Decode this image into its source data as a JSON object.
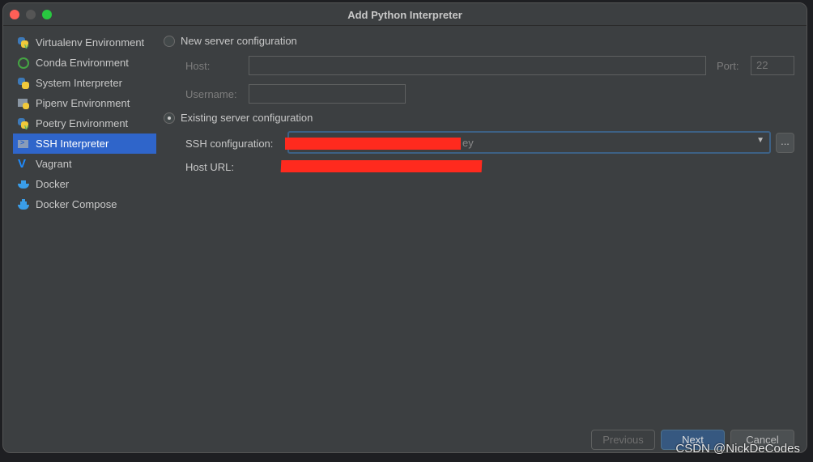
{
  "window": {
    "title": "Add Python Interpreter"
  },
  "sidebar": {
    "items": [
      {
        "label": "Virtualenv Environment",
        "icon": "python-virtualenv-icon"
      },
      {
        "label": "Conda Environment",
        "icon": "conda-icon"
      },
      {
        "label": "System Interpreter",
        "icon": "python-icon"
      },
      {
        "label": "Pipenv Environment",
        "icon": "pipenv-icon"
      },
      {
        "label": "Poetry Environment",
        "icon": "poetry-icon"
      },
      {
        "label": "SSH Interpreter",
        "icon": "ssh-icon",
        "selected": true
      },
      {
        "label": "Vagrant",
        "icon": "vagrant-icon"
      },
      {
        "label": "Docker",
        "icon": "docker-icon"
      },
      {
        "label": "Docker Compose",
        "icon": "docker-compose-icon"
      }
    ]
  },
  "form": {
    "new_server": {
      "label": "New server configuration",
      "selected": false,
      "host_label": "Host:",
      "host_value": "",
      "port_label": "Port:",
      "port_value": "22",
      "username_label": "Username:",
      "username_value": ""
    },
    "existing_server": {
      "label": "Existing server configuration",
      "selected": true,
      "ssh_config_label": "SSH configuration:",
      "ssh_config_visible_suffix": "ey",
      "host_url_label": "Host URL:",
      "more_label": "..."
    }
  },
  "buttons": {
    "previous": "Previous",
    "next": "Next",
    "cancel": "Cancel"
  },
  "watermark": "CSDN @NickDeCodes",
  "colors": {
    "accent": "#2f65ca",
    "redaction": "#ff2a1e",
    "background": "#3c3f41"
  }
}
